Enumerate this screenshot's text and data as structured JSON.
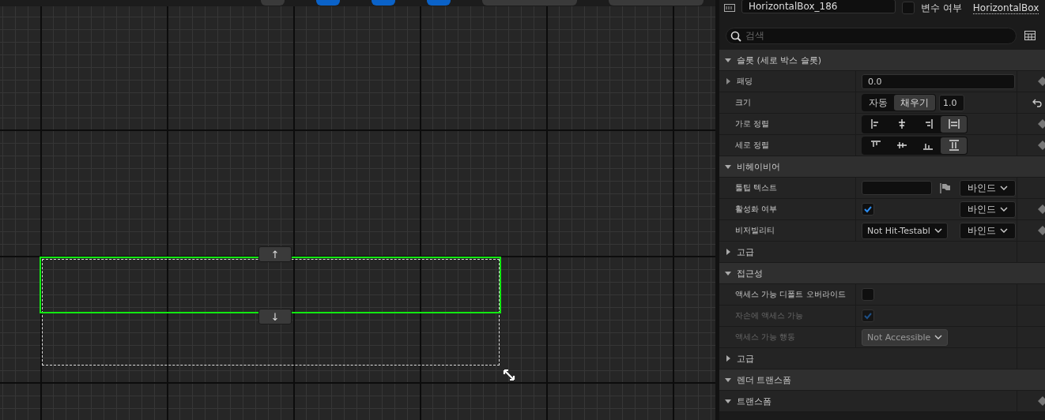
{
  "header": {
    "name": "HorizontalBox_186",
    "is_variable": {
      "label": "변수 여부",
      "checked": false
    },
    "class_link": "HorizontalBox"
  },
  "search": {
    "placeholder": "검색"
  },
  "canvas": {
    "up_button": "↑",
    "down_button": "↓"
  },
  "sections": [
    {
      "title": "슬롯 (세로 박스 슬롯)",
      "expanded": true,
      "rows": [
        {
          "kind": "number",
          "label": "패딩",
          "expanded": false,
          "value": "0.0",
          "keyframe": true
        },
        {
          "kind": "size",
          "label": "크기",
          "options": [
            {
              "label": "자동",
              "selected": false
            },
            {
              "label": "채우기",
              "selected": true
            }
          ],
          "value": "1.0",
          "reset": true
        },
        {
          "kind": "align",
          "label": "가로 정렬",
          "keyframe": true,
          "options": [
            {
              "kind": "left",
              "selected": false
            },
            {
              "kind": "hcenter",
              "selected": false
            },
            {
              "kind": "right",
              "selected": false
            },
            {
              "kind": "hfill",
              "selected": true
            }
          ]
        },
        {
          "kind": "align",
          "label": "세로 정렬",
          "keyframe": true,
          "options": [
            {
              "kind": "top",
              "selected": false
            },
            {
              "kind": "vcenter",
              "selected": false
            },
            {
              "kind": "bottom",
              "selected": false
            },
            {
              "kind": "vfill",
              "selected": true
            }
          ]
        }
      ]
    },
    {
      "title": "비헤이비어",
      "expanded": true,
      "rows": [
        {
          "kind": "text_bind",
          "label": "툴팁 텍스트",
          "bind": "바인드",
          "keyframe": false
        },
        {
          "kind": "check_bind",
          "label": "활성화 여부",
          "checked": true,
          "bind": "바인드",
          "keyframe": true
        },
        {
          "kind": "dropdown_bind",
          "label": "비저빌리티",
          "value": "Not Hit-Testabl",
          "bind": "바인드",
          "keyframe": true
        },
        {
          "kind": "group",
          "label": "고급",
          "expanded": false
        }
      ]
    },
    {
      "title": "접근성",
      "expanded": true,
      "rows": [
        {
          "kind": "check",
          "label": "액세스 가능 디폴트 오버라이드",
          "checked": false,
          "disabled": false
        },
        {
          "kind": "check",
          "label": "자손에 액세스 가능",
          "checked": true,
          "disabled": true
        },
        {
          "kind": "dropdown",
          "label": "액세스 가능 행동",
          "value": "Not Accessible",
          "disabled": true
        },
        {
          "kind": "group",
          "label": "고급",
          "expanded": false
        }
      ]
    },
    {
      "title": "렌더 트랜스폼",
      "expanded": true,
      "rows": [
        {
          "kind": "group",
          "label": "트랜스폼",
          "expanded": true,
          "keyframe": true
        }
      ]
    }
  ]
}
